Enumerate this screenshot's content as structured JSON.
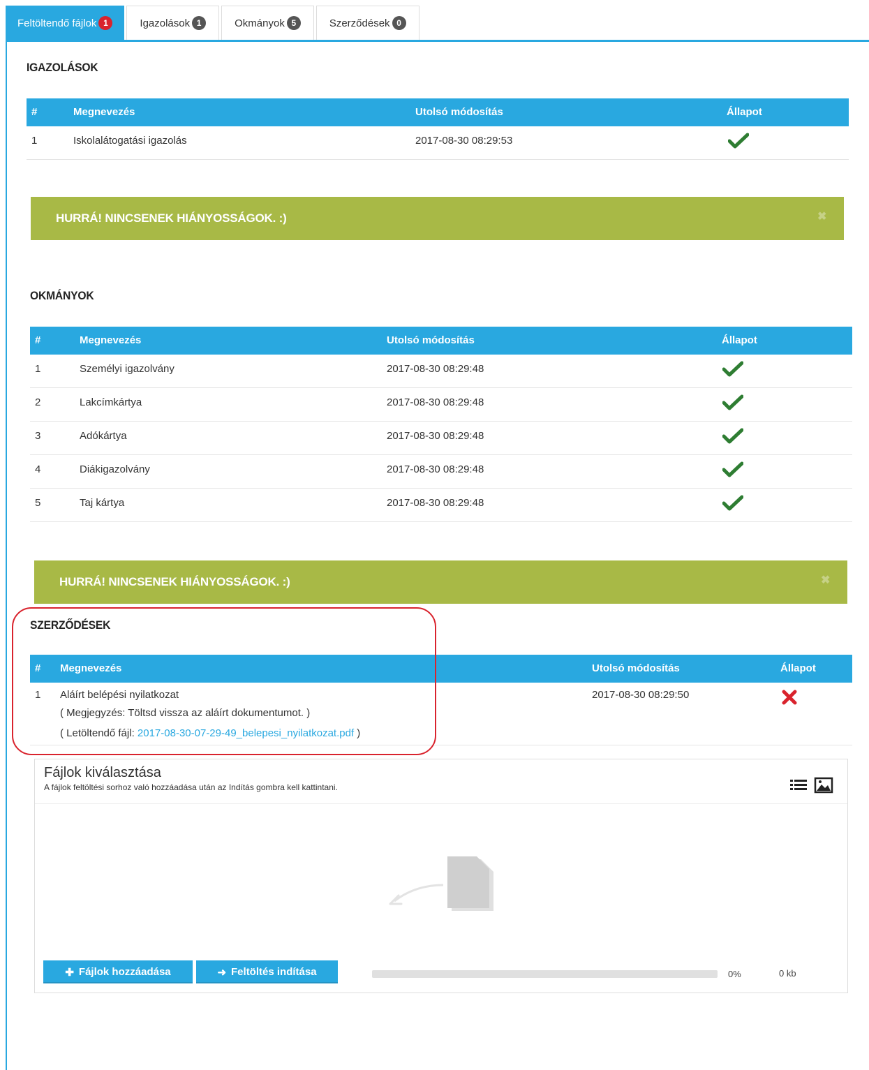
{
  "tabs": [
    {
      "label": "Feltöltendő fájlok",
      "badge": "1"
    },
    {
      "label": "Igazolások",
      "badge": "1"
    },
    {
      "label": "Okmányok",
      "badge": "5"
    },
    {
      "label": "Szerződések",
      "badge": "0"
    }
  ],
  "igazolasok": {
    "title": "IGAZOLÁSOK",
    "headers": {
      "num": "#",
      "name": "Megnevezés",
      "modified": "Utolsó módosítás",
      "status": "Állapot"
    },
    "rows": [
      {
        "num": "1",
        "name": "Iskolalátogatási igazolás",
        "modified": "2017-08-30 08:29:53",
        "status": "ok"
      }
    ],
    "alert": "HURRÁ! NINCSENEK HIÁNYOSSÁGOK. :)"
  },
  "okmanyok": {
    "title": "OKMÁNYOK",
    "headers": {
      "num": "#",
      "name": "Megnevezés",
      "modified": "Utolsó módosítás",
      "status": "Állapot"
    },
    "rows": [
      {
        "num": "1",
        "name": "Személyi igazolvány",
        "modified": "2017-08-30 08:29:48",
        "status": "ok"
      },
      {
        "num": "2",
        "name": "Lakcímkártya",
        "modified": "2017-08-30 08:29:48",
        "status": "ok"
      },
      {
        "num": "3",
        "name": "Adókártya",
        "modified": "2017-08-30 08:29:48",
        "status": "ok"
      },
      {
        "num": "4",
        "name": "Diákigazolvány",
        "modified": "2017-08-30 08:29:48",
        "status": "ok"
      },
      {
        "num": "5",
        "name": "Taj kártya",
        "modified": "2017-08-30 08:29:48",
        "status": "ok"
      }
    ],
    "alert": "HURRÁ! NINCSENEK HIÁNYOSSÁGOK. :)"
  },
  "szerzodesek": {
    "title": "SZERZŐDÉSEK",
    "headers": {
      "num": "#",
      "name": "Megnevezés",
      "modified": "Utolsó módosítás",
      "status": "Állapot"
    },
    "row": {
      "num": "1",
      "name": "Aláírt belépési nyilatkozat",
      "note": "( Megjegyzés: Töltsd vissza az aláírt dokumentumot. )",
      "file_prefix": "( Letöltendő fájl: ",
      "file_link": "2017-08-30-07-29-49_belepesi_nyilatkozat.pdf",
      "file_suffix": " )",
      "modified": "2017-08-30 08:29:50",
      "status": "missing"
    }
  },
  "uploader": {
    "title": "Fájlok kiválasztása",
    "subtitle": "A fájlok feltöltési sorhoz való hozzáadása után az Indítás gombra kell kattintani.",
    "add_button": "Fájlok hozzáadása",
    "start_button": "Feltöltés indítása",
    "progress_percent": "0%",
    "size": "0 kb"
  },
  "colors": {
    "accent": "#29a8e0",
    "success_bar": "#a8b946",
    "check": "#2e7d32",
    "error": "#d9232d"
  }
}
